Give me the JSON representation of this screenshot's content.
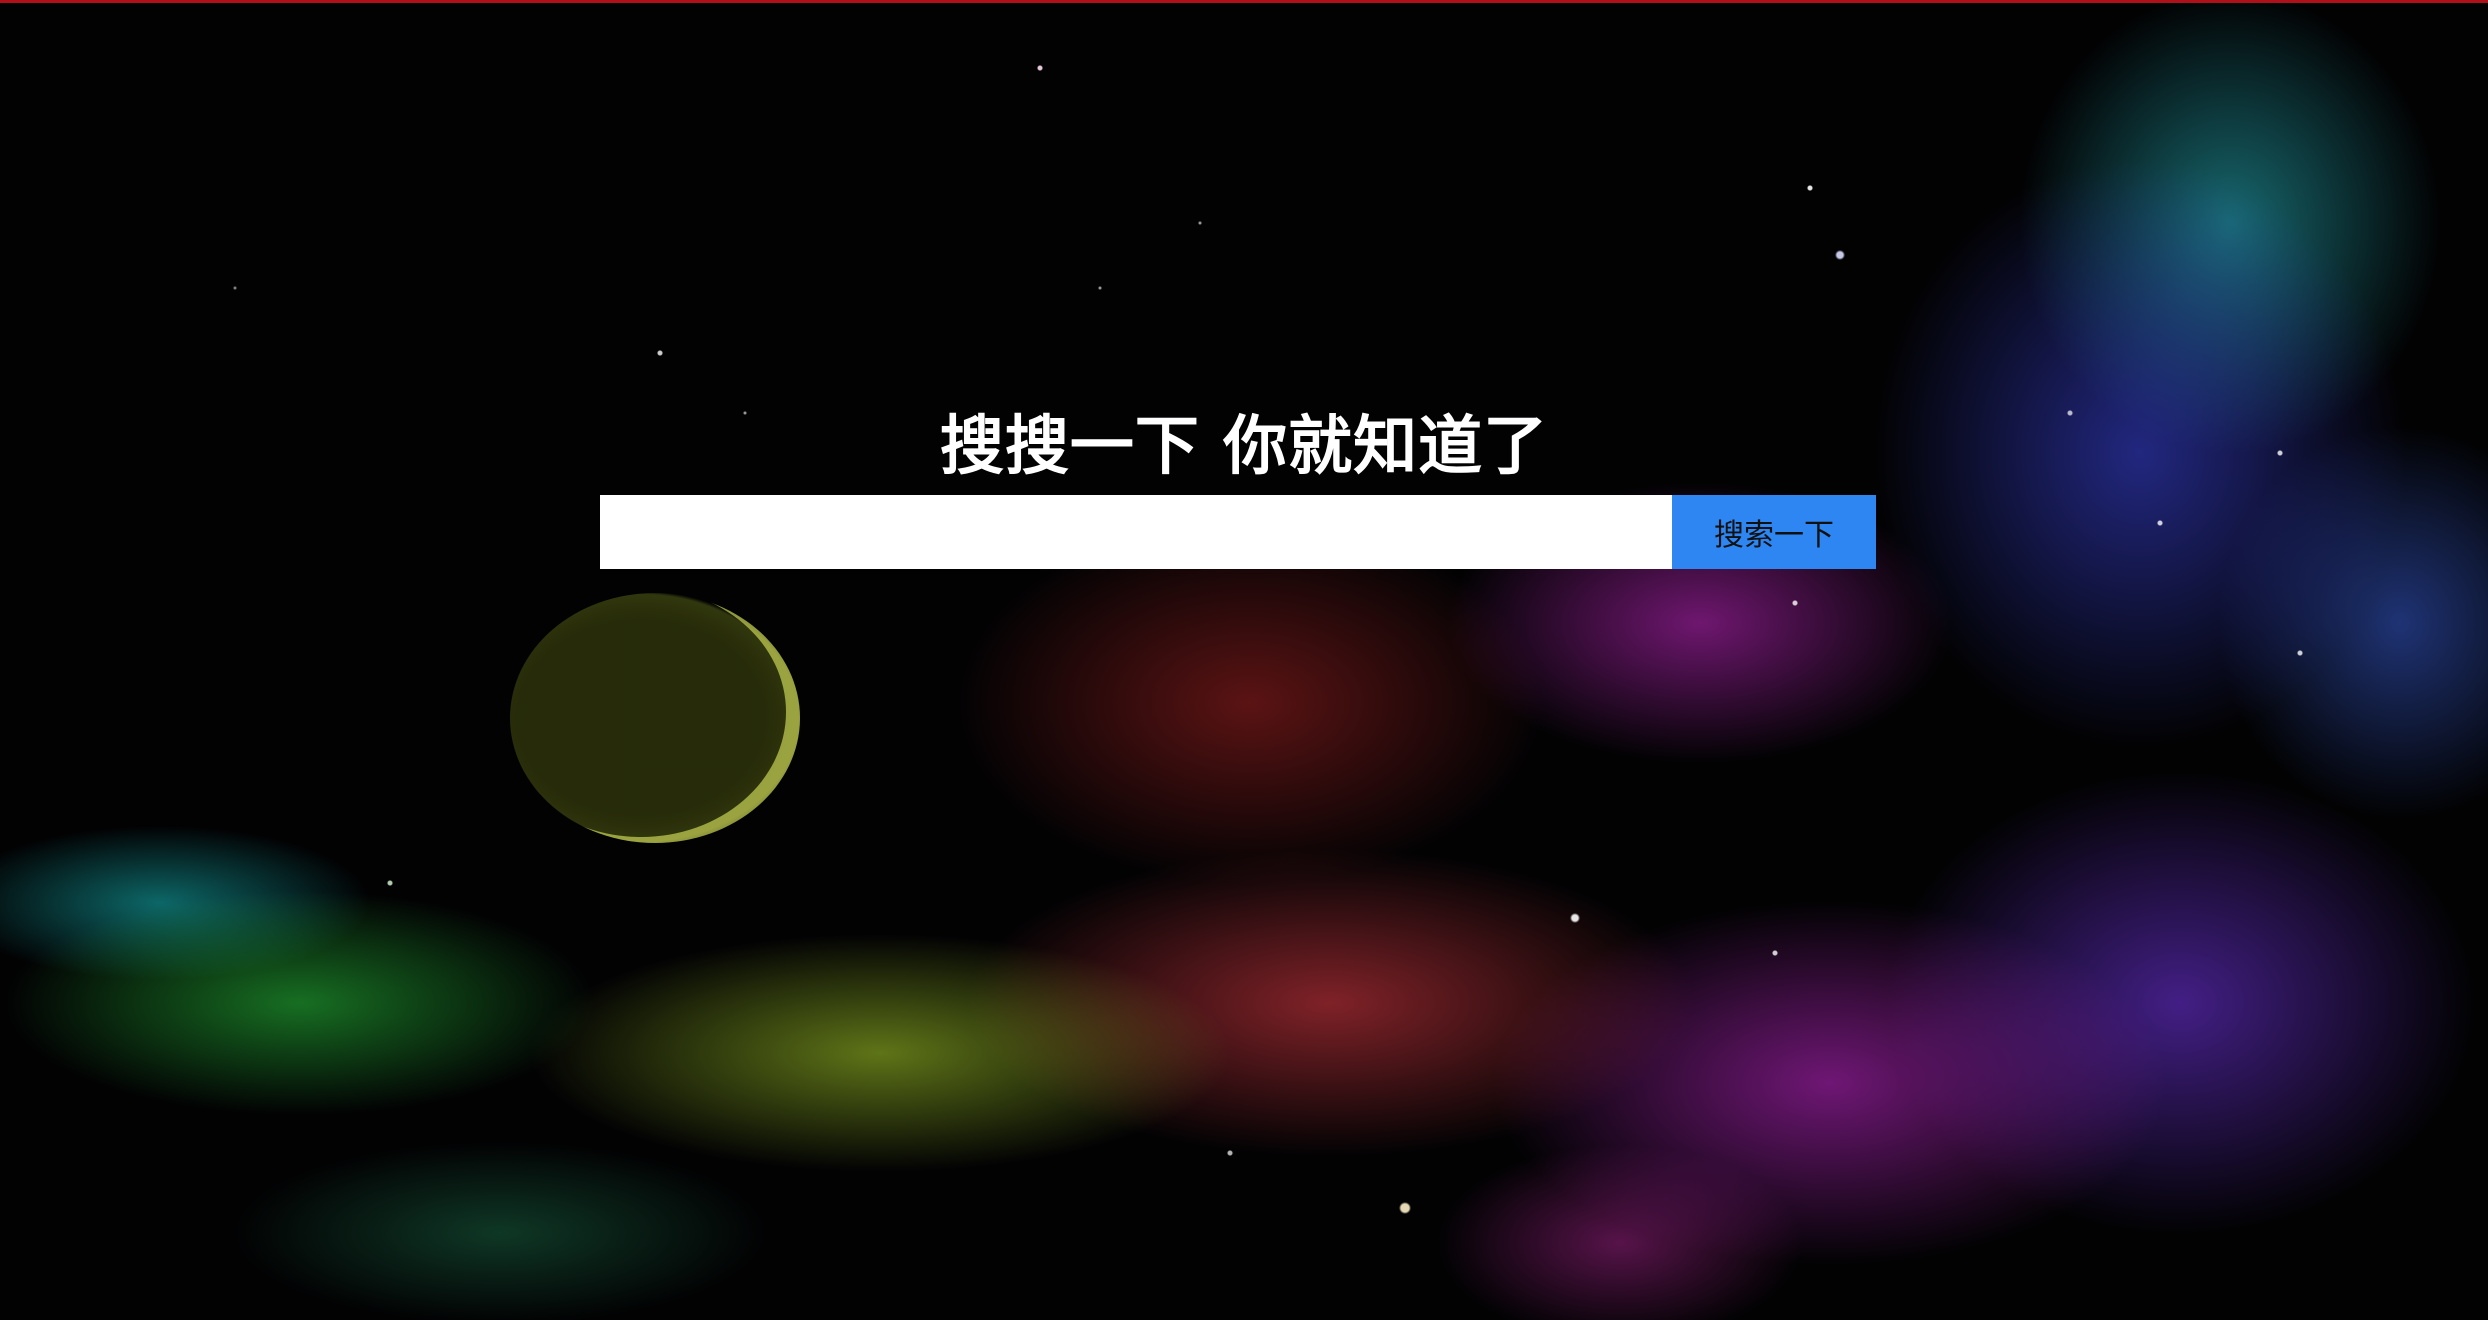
{
  "page": {
    "background_image": "space-nebula-with-crescent-moon",
    "accent_color": "#2e86f2"
  },
  "hero": {
    "headline": "搜搜一下 你就知道了"
  },
  "search": {
    "input_value": "",
    "placeholder": "",
    "button_label": "搜索一下"
  }
}
